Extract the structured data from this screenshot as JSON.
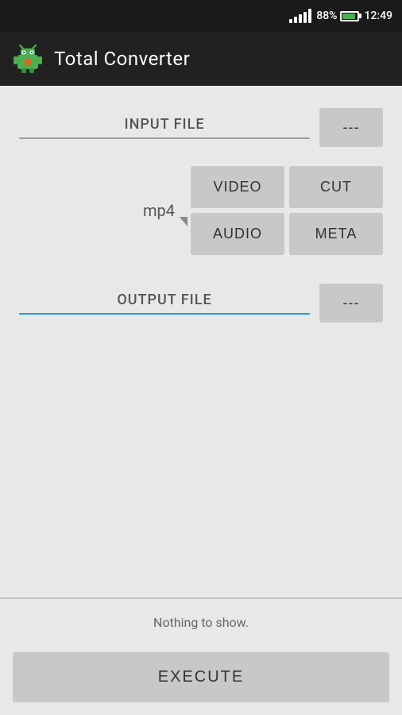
{
  "status_bar": {
    "battery_percent": "88%",
    "time": "12:49"
  },
  "app_bar": {
    "title": "Total Converter",
    "icon_alt": "app-icon"
  },
  "input_file": {
    "label": "INPUT FILE",
    "browse_label": "---",
    "underline_color": "#9e9e9e"
  },
  "format_section": {
    "current_format": "mp4"
  },
  "action_buttons": {
    "video_label": "VIDEO",
    "cut_label": "CUT",
    "audio_label": "AUDIO",
    "meta_label": "META"
  },
  "output_file": {
    "label": "OUTPUT FILE",
    "browse_label": "---",
    "underline_color": "#2196f3"
  },
  "empty_state": {
    "message": "Nothing to show."
  },
  "execute_button": {
    "label": "EXECUTE"
  }
}
